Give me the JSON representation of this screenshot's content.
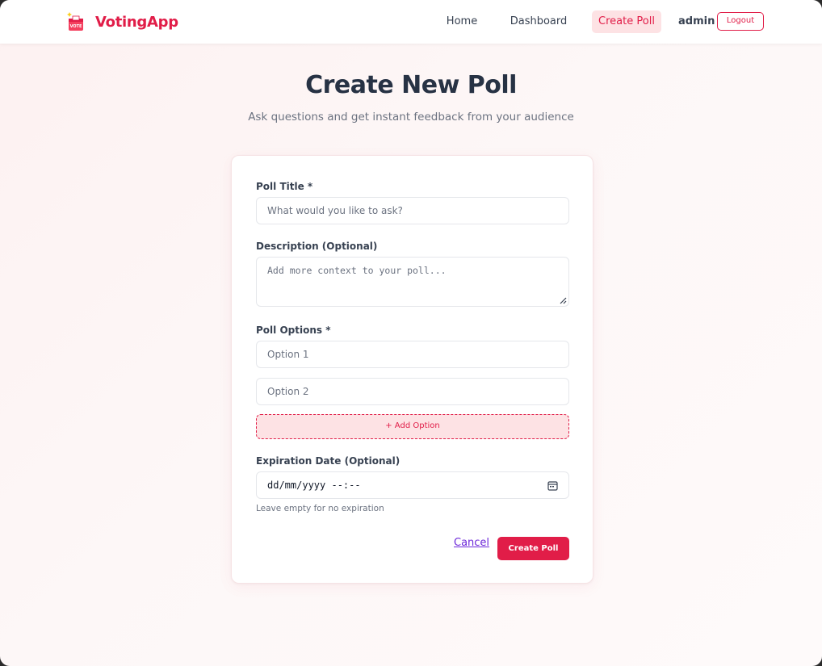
{
  "header": {
    "brand": "VotingApp",
    "logo_badge_text": "VOTE",
    "nav": {
      "home": "Home",
      "dashboard": "Dashboard",
      "create_poll": "Create Poll"
    },
    "username": "admin",
    "logout_label": "Logout"
  },
  "page": {
    "title": "Create New Poll",
    "subtitle": "Ask questions and get instant feedback from your audience"
  },
  "form": {
    "poll_title": {
      "label": "Poll Title *",
      "placeholder": "What would you like to ask?",
      "value": ""
    },
    "description": {
      "label": "Description (Optional)",
      "placeholder": "Add more context to your poll...",
      "value": ""
    },
    "options": {
      "label": "Poll Options *",
      "items": [
        {
          "placeholder": "Option 1",
          "value": ""
        },
        {
          "placeholder": "Option 2",
          "value": ""
        }
      ],
      "add_label": "+ Add Option"
    },
    "expiration": {
      "label": "Expiration Date (Optional)",
      "display": "dd/mm/yyyy --:--",
      "hint": "Leave empty for no expiration"
    },
    "cancel_label": "Cancel",
    "submit_label": "Create Poll"
  },
  "colors": {
    "accent": "#e11d48",
    "accent_light": "#fde2e4",
    "heading": "#273244",
    "muted": "#6b7280"
  },
  "icons": {
    "logo": "ballot-box-icon",
    "calendar": "calendar-icon",
    "resize": "resize-handle-icon"
  }
}
